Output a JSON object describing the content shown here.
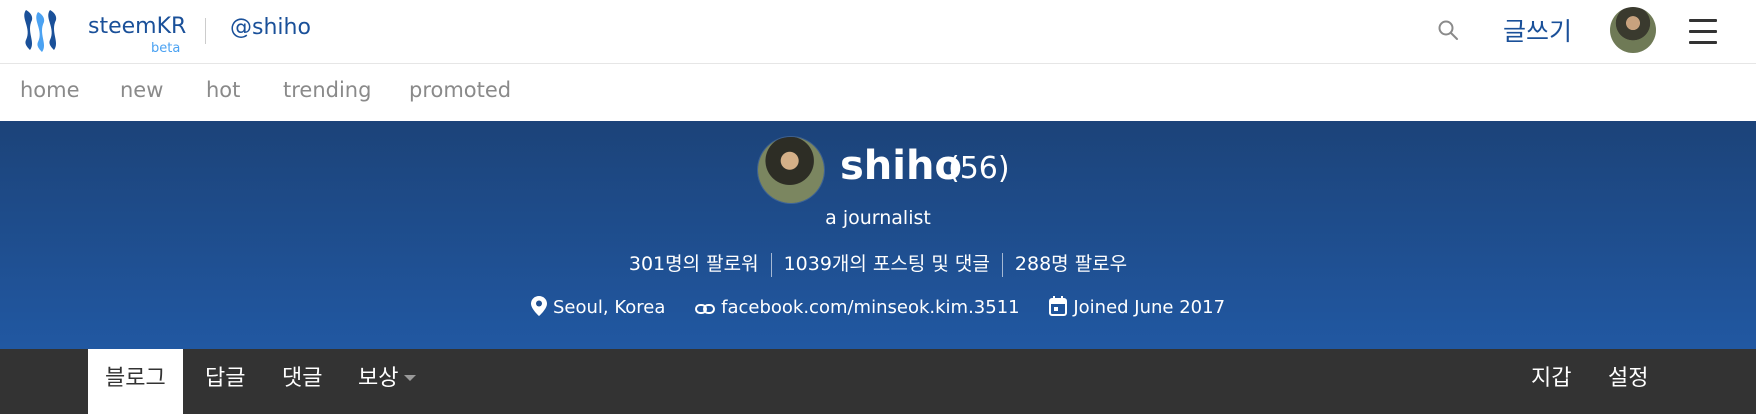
{
  "header": {
    "brand": "steemKR",
    "beta": "beta",
    "crumb": "@shiho",
    "write_label": "글쓰기"
  },
  "subnav": [
    "home",
    "new",
    "hot",
    "trending",
    "promoted"
  ],
  "profile": {
    "name": "shiho",
    "reputation": "(56)",
    "about": "a journalist",
    "followers": "301명의 팔로워",
    "posts": "1039개의 포스팅 및 댓글",
    "following": "288명 팔로우",
    "location": "Seoul, Korea",
    "website": "facebook.com/minseok.kim.3511",
    "joined": "Joined June 2017"
  },
  "tabs": {
    "blog": "블로그",
    "replies": "답글",
    "comments": "댓글",
    "rewards": "보상",
    "wallet": "지갑",
    "settings": "설정"
  },
  "colors": {
    "brand_blue": "#1a5099",
    "hero_top": "#1c4379",
    "hero_bottom": "#2158a2",
    "tabbar": "#333333"
  },
  "icons": [
    "steem-logo-icon",
    "search-icon",
    "hamburger-menu-icon",
    "location-pin-icon",
    "link-icon",
    "calendar-icon",
    "chevron-down-icon"
  ]
}
